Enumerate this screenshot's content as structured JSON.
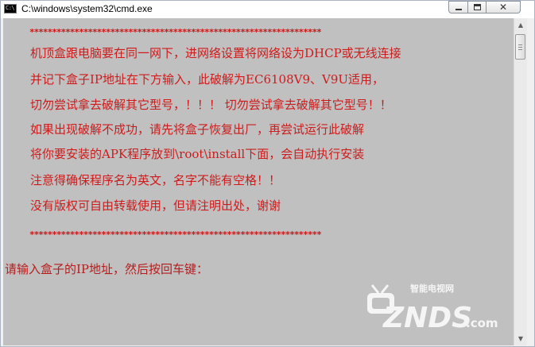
{
  "window": {
    "title": "C:\\windows\\system32\\cmd.exe",
    "icon_label": "C:\\"
  },
  "controls": {
    "minimize": "minimize-icon",
    "maximize": "maximize-icon",
    "close": "close-icon",
    "close_glyph": "✕"
  },
  "console": {
    "background": "#c0c0c0",
    "text_color": "#ce1b1b",
    "separator_top": "*****************************************************************",
    "lines": [
      "机顶盒跟电脑要在同一网下，进网络设置将网络设为DHCP或无线连接",
      "并记下盒子IP地址在下方输入，此破解为EC6108V9、V9U适用，",
      "切勿尝试拿去破解其它型号，！！！ 切勿尝试拿去破解其它型号！！",
      "如果出现破解不成功，请先将盒子恢复出厂，再尝试运行此破解",
      "将你要安装的APK程序放到\\root\\install下面，会自动执行安装",
      "注意得确保程序名为英文，名字不能有空格！！",
      "没有版权可自由转载使用，但请注明出处，谢谢"
    ],
    "separator_bottom": "*****************************************************************",
    "prompt": "请输入盒子的IP地址，然后按回车键："
  },
  "watermark": {
    "brand": "ZNDS",
    "suffix": ".com",
    "tagline": "智能电视网"
  },
  "scrollbar": {
    "up_arrow": "▲",
    "down_arrow": "▼",
    "position": 0
  }
}
